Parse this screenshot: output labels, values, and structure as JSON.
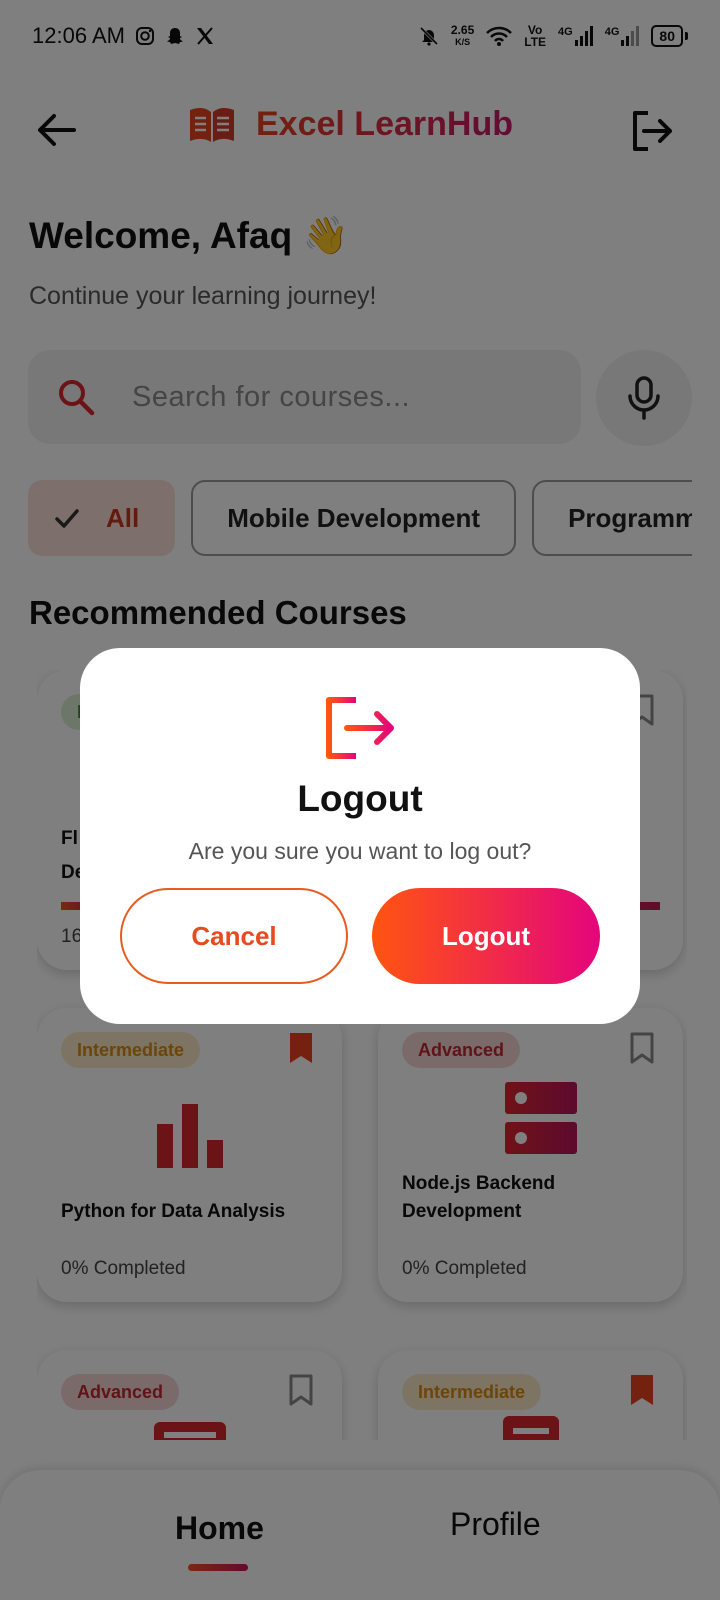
{
  "status_bar": {
    "time": "12:06 AM",
    "net_speed_value": "2.65",
    "net_speed_unit": "K/S",
    "volte_top": "Vo",
    "volte_bottom": "LTE",
    "signal1_label": "4G",
    "signal2_label": "4G",
    "battery": "80"
  },
  "header": {
    "app_title": "Excel LearnHub"
  },
  "welcome": {
    "title": "Welcome, Afaq 👋",
    "subtitle": "Continue your learning journey!"
  },
  "search": {
    "placeholder": "Search for courses..."
  },
  "filters": [
    {
      "label": "All",
      "selected": true
    },
    {
      "label": "Mobile Development",
      "selected": false
    },
    {
      "label": "Programming",
      "selected": false
    }
  ],
  "section_title": "Recommended Courses",
  "courses": [
    {
      "level": "Beginner",
      "level_visible": "B",
      "title_line1": "Fl",
      "title_line2": "De",
      "progress": "16",
      "progress_percent": 16,
      "bookmarked": false
    },
    {
      "level": "",
      "title_line1": "",
      "title_line2": "",
      "progress": "",
      "bookmarked": false
    },
    {
      "level": "Intermediate",
      "title": "Python for Data Analysis",
      "progress": "0% Completed",
      "progress_percent": 0,
      "bookmarked": true
    },
    {
      "level": "Advanced",
      "title_line1": "Node.js Backend",
      "title_line2": "Development",
      "progress": "0% Completed",
      "progress_percent": 0,
      "bookmarked": false
    },
    {
      "level": "Advanced",
      "bookmarked": false
    },
    {
      "level": "Intermediate",
      "bookmarked": true
    }
  ],
  "dialog": {
    "title": "Logout",
    "message": "Are you sure you want to log out?",
    "cancel_label": "Cancel",
    "confirm_label": "Logout"
  },
  "bottom_nav": {
    "home_label": "Home",
    "profile_label": "Profile"
  },
  "colors": {
    "accent_start": "#ff5510",
    "accent_end": "#e4057c",
    "brand_red": "#c8341f"
  }
}
